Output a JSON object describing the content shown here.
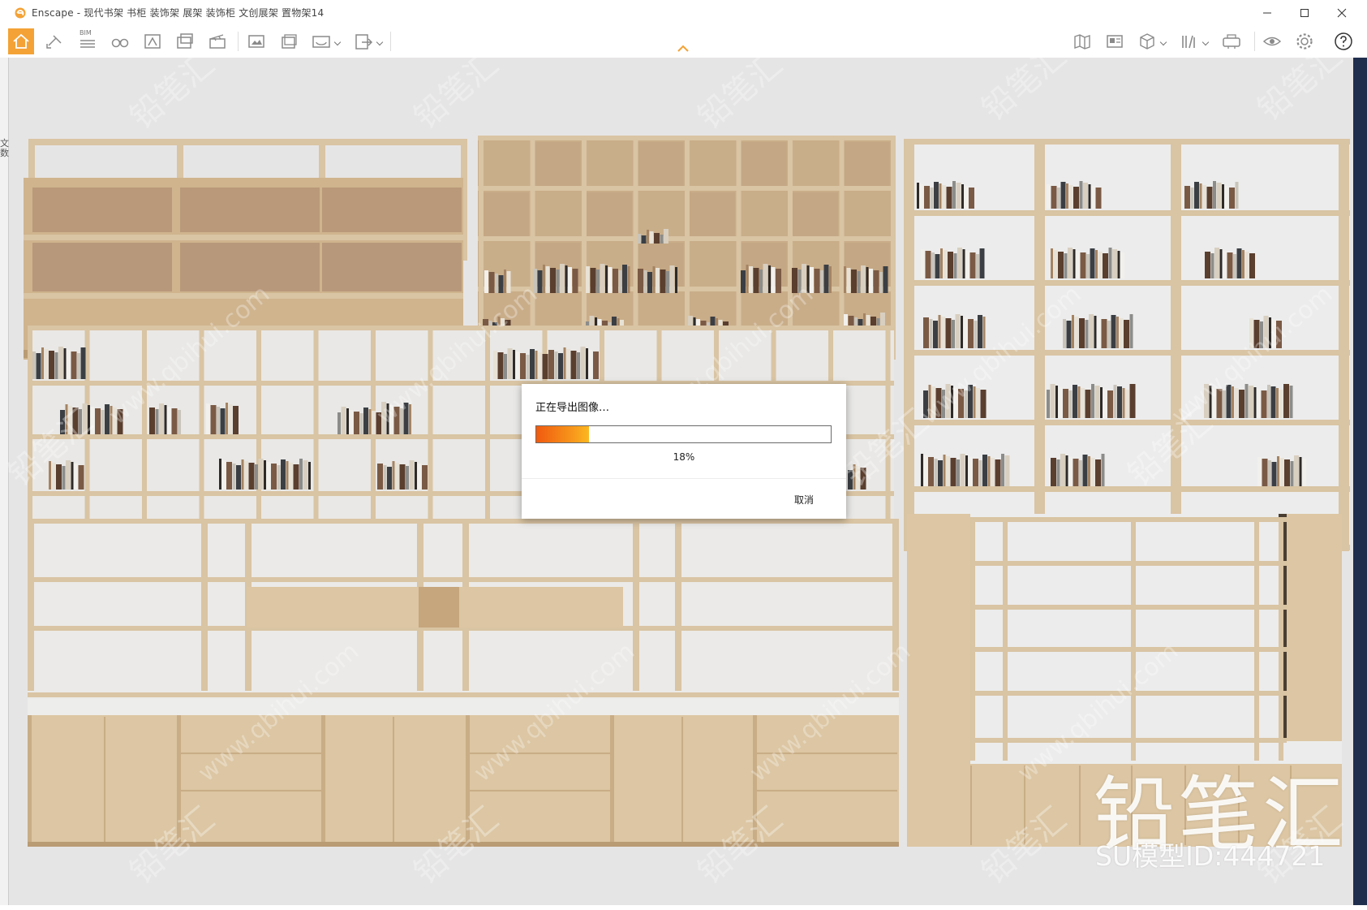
{
  "window": {
    "title": "Enscape - 现代书架 书柜 装饰架 展架 装饰柜 文创展架 置物架14",
    "accent_color": "#f4a236"
  },
  "toolbar": {
    "bim_label": "BIM",
    "tools": [
      {
        "name": "home-icon",
        "active": true
      },
      {
        "name": "sync-icon"
      },
      {
        "name": "bim-icon"
      },
      {
        "name": "binoculars-icon"
      },
      {
        "name": "asset-library-icon"
      },
      {
        "name": "views-icon"
      },
      {
        "name": "video-editor-icon"
      },
      {
        "name": "screenshot-icon"
      },
      {
        "name": "batch-render-icon"
      },
      {
        "name": "panorama-icon"
      },
      {
        "name": "export-icon"
      },
      {
        "name": "map-icon"
      },
      {
        "name": "material-editor-icon"
      },
      {
        "name": "cube-icon"
      },
      {
        "name": "library-icon"
      },
      {
        "name": "vr-headset-icon"
      },
      {
        "name": "visual-settings-icon"
      },
      {
        "name": "settings-icon"
      },
      {
        "name": "help-icon"
      }
    ]
  },
  "left_panel_text": "文数",
  "dialog": {
    "title": "正在导出图像…",
    "progress": 0.18,
    "percent_label": "18%",
    "cancel_label": "取消"
  },
  "watermark": {
    "brand": "铅笔汇",
    "model_id": "SU模型ID:444721",
    "url": "www.qbihui.com"
  }
}
